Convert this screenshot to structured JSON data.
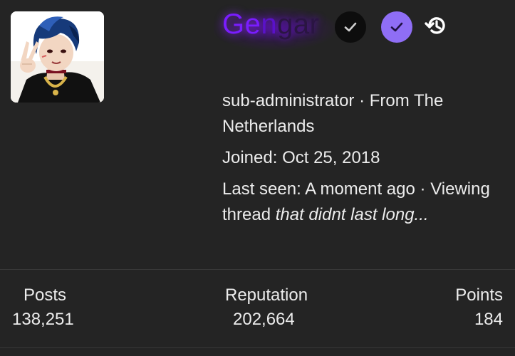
{
  "profile": {
    "username": {
      "part_a": "Ge",
      "part_b": "n",
      "part_c": "gar"
    },
    "badges": [
      {
        "name": "check-dark-badge",
        "color": "#0d0d0d"
      },
      {
        "name": "staff-check-badge",
        "color": "#8f6ef5"
      }
    ],
    "history_icon": "history-icon",
    "role": "sub-administrator",
    "separator": "·",
    "location": "From The Netherlands",
    "joined_label": "Joined:",
    "joined_date": "Oct 25, 2018",
    "last_seen_label": "Last seen:",
    "last_seen_value": "A moment ago",
    "activity_prefix": "Viewing thread",
    "activity_thread": "that didnt last long..."
  },
  "stats": [
    {
      "label": "Posts",
      "value": "138,251"
    },
    {
      "label": "Reputation",
      "value": "202,664"
    },
    {
      "label": "Points",
      "value": "184"
    }
  ],
  "colors": {
    "background": "#242424",
    "username_glow": "#7a1dff",
    "divider": "#383838"
  }
}
